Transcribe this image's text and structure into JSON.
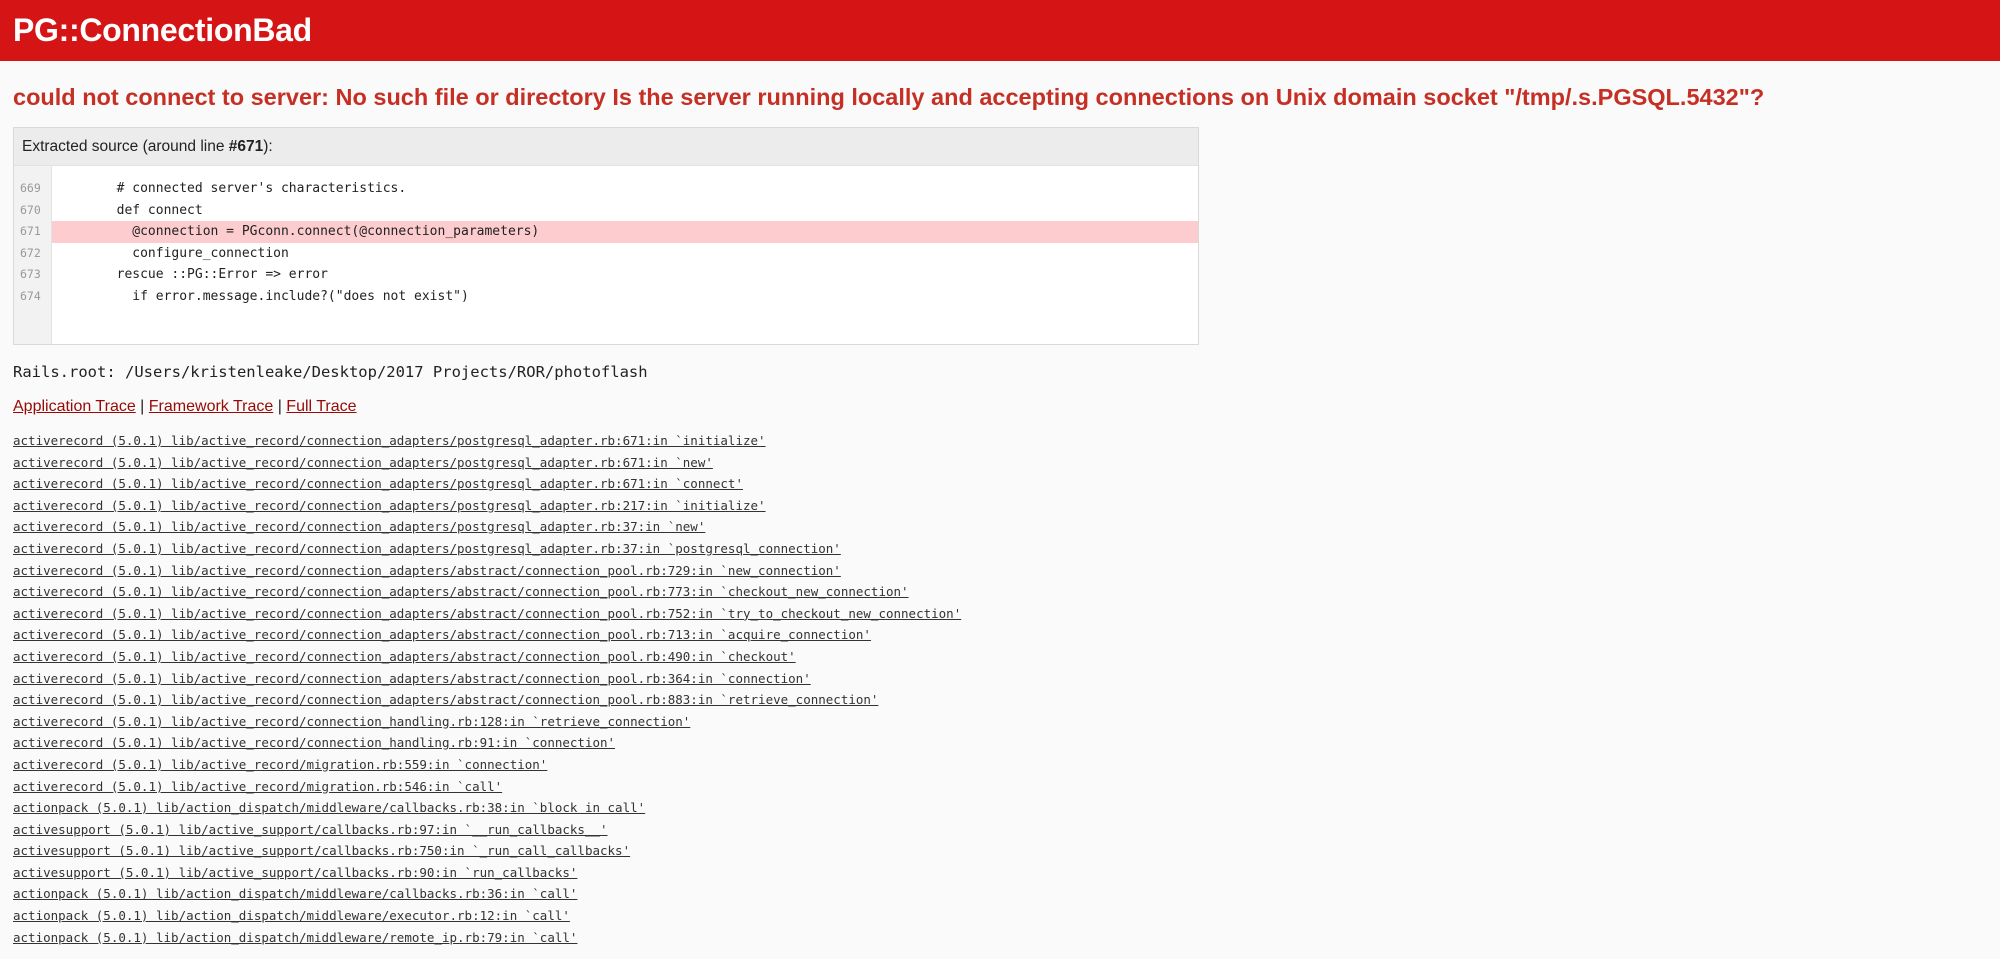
{
  "header": {
    "title": "PG::ConnectionBad"
  },
  "error_message": "could not connect to server: No such file or directory Is the server running locally and accepting connections on Unix domain socket \"/tmp/.s.PGSQL.5432\"?",
  "source": {
    "info_prefix": "Extracted source (around line ",
    "info_line": "#671",
    "info_suffix": "):",
    "line_numbers": [
      "669",
      "670",
      "671",
      "672",
      "673",
      "674"
    ],
    "lines": [
      "        # connected server's characteristics.",
      "        def connect",
      "          @connection = PGconn.connect(@connection_parameters)",
      "          configure_connection",
      "        rescue ::PG::Error => error",
      "          if error.message.include?(\"does not exist\")"
    ],
    "highlighted_index": 2
  },
  "rails_root": "Rails.root: /Users/kristenleake/Desktop/2017 Projects/ROR/photoflash",
  "trace_nav": {
    "application": "Application Trace",
    "framework": "Framework Trace",
    "full": "Full Trace",
    "separator": " | "
  },
  "trace": [
    "activerecord (5.0.1) lib/active_record/connection_adapters/postgresql_adapter.rb:671:in `initialize'",
    "activerecord (5.0.1) lib/active_record/connection_adapters/postgresql_adapter.rb:671:in `new'",
    "activerecord (5.0.1) lib/active_record/connection_adapters/postgresql_adapter.rb:671:in `connect'",
    "activerecord (5.0.1) lib/active_record/connection_adapters/postgresql_adapter.rb:217:in `initialize'",
    "activerecord (5.0.1) lib/active_record/connection_adapters/postgresql_adapter.rb:37:in `new'",
    "activerecord (5.0.1) lib/active_record/connection_adapters/postgresql_adapter.rb:37:in `postgresql_connection'",
    "activerecord (5.0.1) lib/active_record/connection_adapters/abstract/connection_pool.rb:729:in `new_connection'",
    "activerecord (5.0.1) lib/active_record/connection_adapters/abstract/connection_pool.rb:773:in `checkout_new_connection'",
    "activerecord (5.0.1) lib/active_record/connection_adapters/abstract/connection_pool.rb:752:in `try_to_checkout_new_connection'",
    "activerecord (5.0.1) lib/active_record/connection_adapters/abstract/connection_pool.rb:713:in `acquire_connection'",
    "activerecord (5.0.1) lib/active_record/connection_adapters/abstract/connection_pool.rb:490:in `checkout'",
    "activerecord (5.0.1) lib/active_record/connection_adapters/abstract/connection_pool.rb:364:in `connection'",
    "activerecord (5.0.1) lib/active_record/connection_adapters/abstract/connection_pool.rb:883:in `retrieve_connection'",
    "activerecord (5.0.1) lib/active_record/connection_handling.rb:128:in `retrieve_connection'",
    "activerecord (5.0.1) lib/active_record/connection_handling.rb:91:in `connection'",
    "activerecord (5.0.1) lib/active_record/migration.rb:559:in `connection'",
    "activerecord (5.0.1) lib/active_record/migration.rb:546:in `call'",
    "actionpack (5.0.1) lib/action_dispatch/middleware/callbacks.rb:38:in `block in call'",
    "activesupport (5.0.1) lib/active_support/callbacks.rb:97:in `__run_callbacks__'",
    "activesupport (5.0.1) lib/active_support/callbacks.rb:750:in `_run_call_callbacks'",
    "activesupport (5.0.1) lib/active_support/callbacks.rb:90:in `run_callbacks'",
    "actionpack (5.0.1) lib/action_dispatch/middleware/callbacks.rb:36:in `call'",
    "actionpack (5.0.1) lib/action_dispatch/middleware/executor.rb:12:in `call'",
    "actionpack (5.0.1) lib/action_dispatch/middleware/remote_ip.rb:79:in `call'"
  ],
  "colors": {
    "header_bg": "#d51515",
    "error_text": "#c52f24",
    "highlight_line": "#fcccce",
    "link": "#980905"
  }
}
